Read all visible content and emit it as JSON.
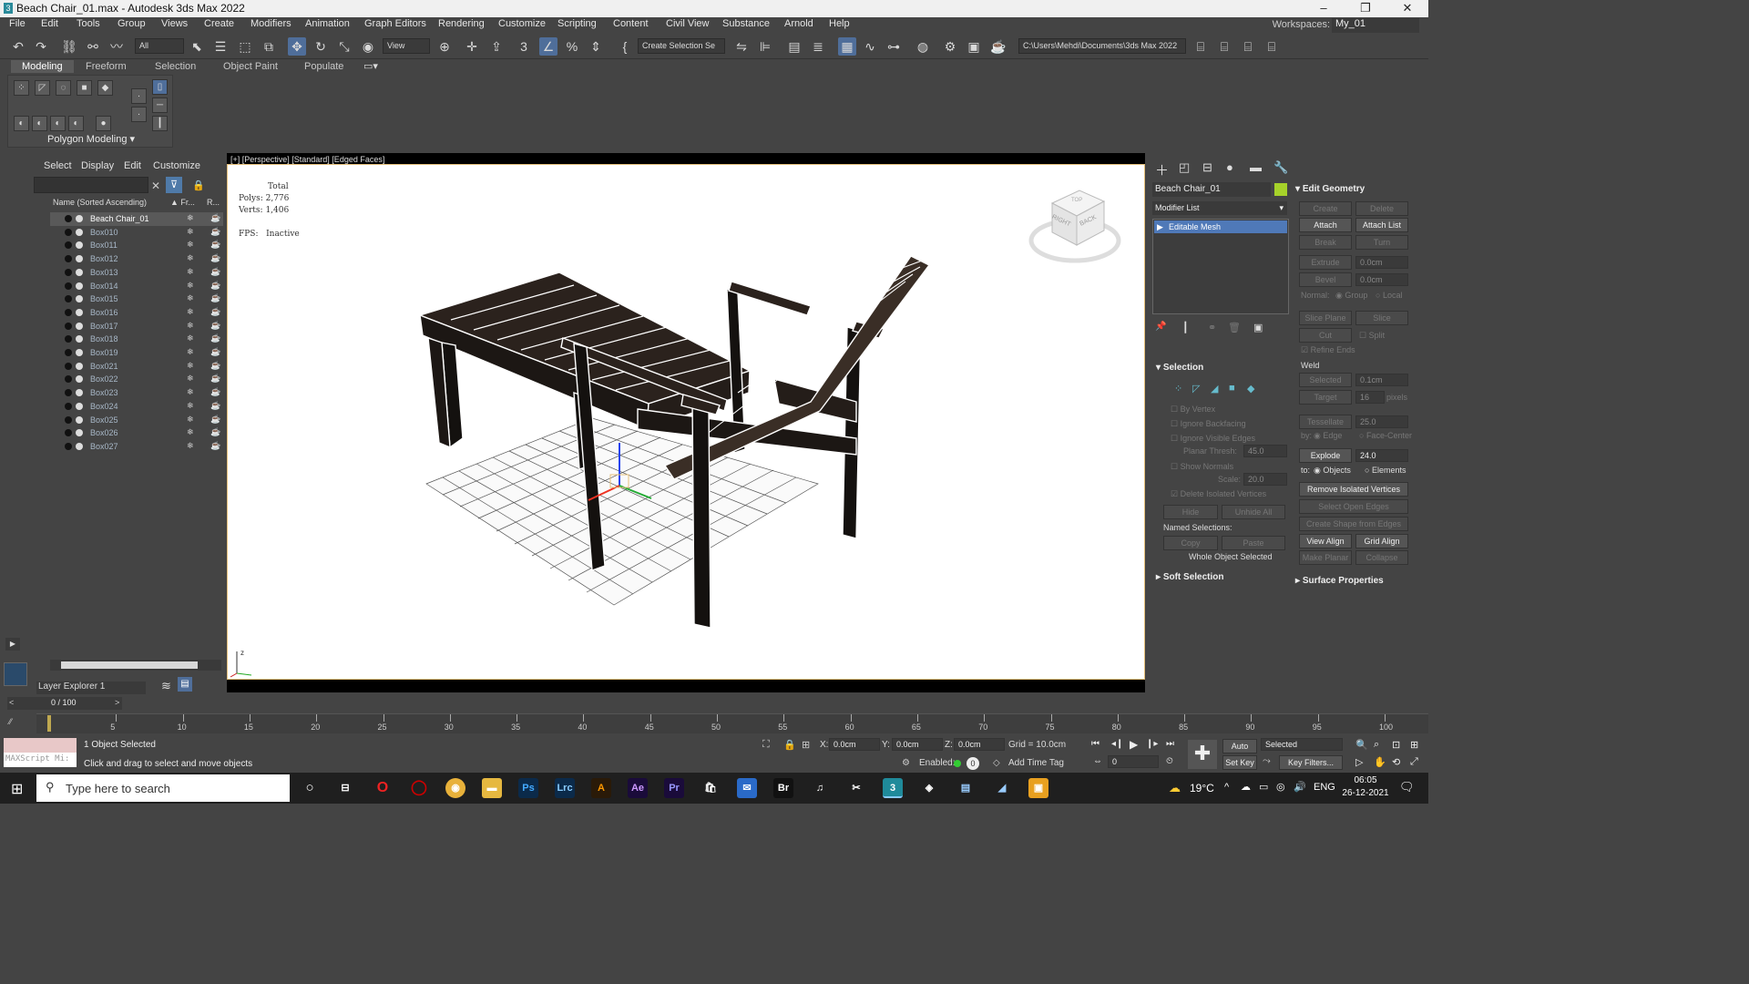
{
  "window": {
    "title": "Beach Chair_01.max - Autodesk 3ds Max 2022",
    "controls": [
      "–",
      "❐",
      "✕"
    ]
  },
  "menu": {
    "items": [
      "File",
      "Edit",
      "Tools",
      "Group",
      "Views",
      "Create",
      "Modifiers",
      "Animation",
      "Graph Editors",
      "Rendering",
      "Customize",
      "Scripting",
      "Content",
      "Civil View",
      "Substance",
      "Arnold",
      "Help"
    ],
    "workspaces_label": "Workspaces:",
    "workspaces_value": "My_01"
  },
  "toolbar": {
    "filter": "All",
    "refcoord": "View",
    "selset": "Create Selection Se",
    "path": "C:\\Users\\Mehdi\\Documents\\3ds Max 2022"
  },
  "ribbon": {
    "tabs": [
      "Modeling",
      "Freeform",
      "Selection",
      "Object Paint",
      "Populate"
    ],
    "label": "Polygon Modeling"
  },
  "scene": {
    "tabs": [
      "Select",
      "Display",
      "Edit",
      "Customize"
    ],
    "header": {
      "name": "Name (Sorted Ascending)",
      "frozen": "▲ Fr...",
      "render": "R..."
    },
    "rows": [
      "Beach Chair_01",
      "Box010",
      "Box011",
      "Box012",
      "Box013",
      "Box014",
      "Box015",
      "Box016",
      "Box017",
      "Box018",
      "Box019",
      "Box021",
      "Box022",
      "Box023",
      "Box024",
      "Box025",
      "Box026",
      "Box027"
    ],
    "layer": "Layer Explorer 1"
  },
  "viewport": {
    "label": "[+] [Perspective] [Standard] [Edged Faces]",
    "stats_total": "Total",
    "polys_label": "Polys:",
    "polys": "2,776",
    "verts_label": "Verts:",
    "verts": "1,406",
    "fps_label": "FPS:",
    "fps": "Inactive",
    "cube_right": "RIGHT",
    "cube_back": "BACK",
    "cube_top": "TOP"
  },
  "cmd": {
    "object_name": "Beach Chair_01",
    "modifier_list": "Modifier List",
    "stack_item": "Editable Mesh",
    "edit_geometry": {
      "title": "Edit Geometry",
      "create": "Create",
      "delete": "Delete",
      "attach": "Attach",
      "attach_list": "Attach List",
      "break": "Break",
      "turn": "Turn",
      "extrude": "Extrude",
      "extrude_val": "0.0cm",
      "bevel": "Bevel",
      "bevel_val": "0.0cm",
      "normal": "Normal:",
      "group": "Group",
      "local": "Local",
      "slice_plane": "Slice Plane",
      "slice": "Slice",
      "cut": "Cut",
      "split": "Split",
      "refine": "Refine Ends",
      "weld": "Weld",
      "selected": "Selected",
      "selected_val": "0.1cm",
      "target": "Target",
      "target_val": "16",
      "pixels": "pixels",
      "tessellate": "Tessellate",
      "tess_val": "25.0",
      "by": "by:",
      "edge": "Edge",
      "face_center": "Face-Center",
      "explode": "Explode",
      "explode_val": "24.0",
      "to": "to:",
      "objects": "Objects",
      "elements": "Elements",
      "remove_iso": "Remove Isolated Vertices",
      "select_open": "Select Open Edges",
      "create_shape": "Create Shape from Edges",
      "view_align": "View Align",
      "grid_align": "Grid Align",
      "make_planar": "Make Planar",
      "collapse": "Collapse",
      "surface_props": "Surface Properties"
    },
    "selection": {
      "title": "Selection",
      "by_vertex": "By Vertex",
      "ignore_backfacing": "Ignore Backfacing",
      "ignore_visible": "Ignore Visible Edges",
      "planar_thresh": "Planar Thresh:",
      "planar_val": "45.0",
      "show_normals": "Show Normals",
      "scale": "Scale:",
      "scale_val": "20.0",
      "delete_iso": "Delete Isolated Vertices",
      "hide": "Hide",
      "unhide_all": "Unhide All",
      "named_sel": "Named Selections:",
      "copy": "Copy",
      "paste": "Paste",
      "whole": "Whole Object Selected"
    },
    "soft_selection": "Soft Selection"
  },
  "timeline": {
    "frame": "0 / 100",
    "ticks": [
      "5",
      "10",
      "15",
      "20",
      "25",
      "30",
      "35",
      "40",
      "45",
      "50",
      "55",
      "60",
      "65",
      "70",
      "75",
      "80",
      "85",
      "90",
      "95",
      "100"
    ]
  },
  "status": {
    "selected": "1 Object Selected",
    "hint": "Click and drag to select and move objects",
    "maxscript": "MAXScript Mi:",
    "x_label": "X:",
    "x": "0.0cm",
    "y_label": "Y:",
    "y": "0.0cm",
    "z_label": "Z:",
    "z": "0.0cm",
    "grid": "Grid = 10.0cm",
    "enabled": "Enabled:",
    "add_time_tag": "Add Time Tag",
    "auto_key": "Auto Key",
    "set_key": "Set Key",
    "key_mode": "Selected",
    "key_filters": "Key Filters...",
    "frame_field": "0"
  },
  "taskbar": {
    "search": "Type here to search",
    "temp": "19°C",
    "lang": "ENG",
    "time": "06:05",
    "date": "26-12-2021"
  }
}
